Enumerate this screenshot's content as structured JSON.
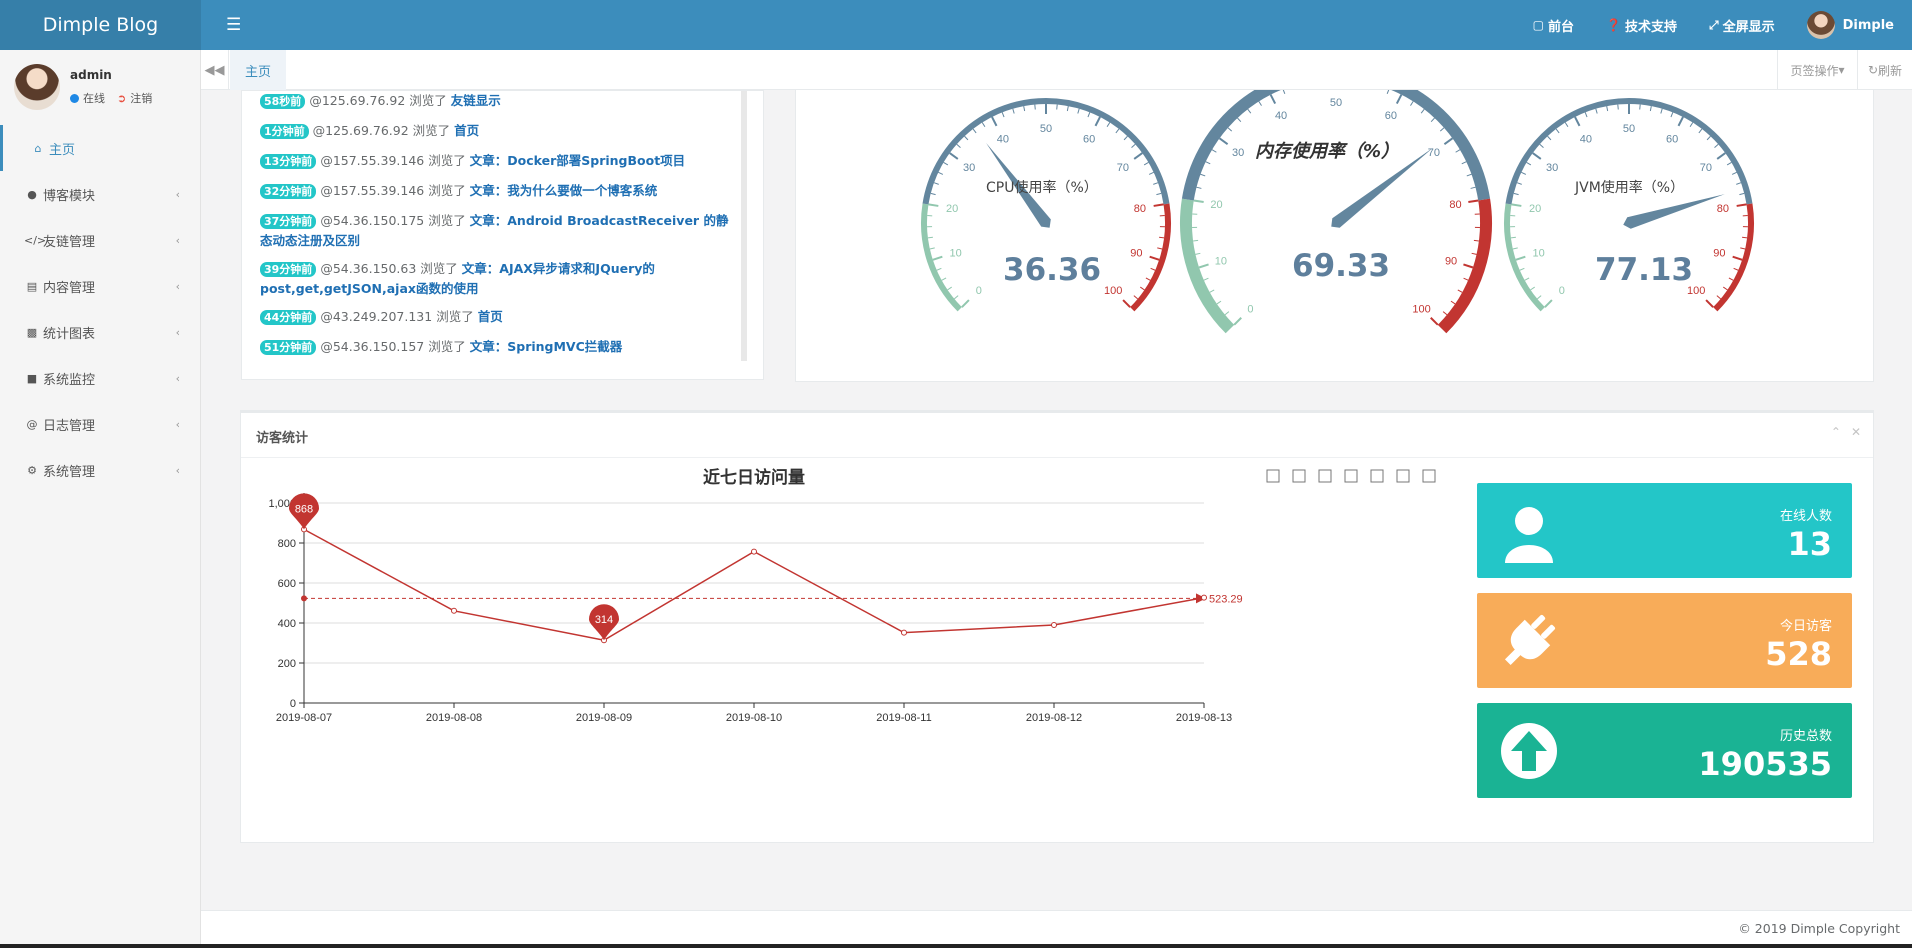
{
  "header": {
    "brand": "Dimple Blog",
    "nav": [
      {
        "icon": "monitor-icon",
        "label": "前台"
      },
      {
        "icon": "question-icon",
        "label": "技术支持"
      },
      {
        "icon": "fullscreen-icon",
        "label": "全屏显示"
      }
    ],
    "username": "Dimple"
  },
  "sidebar": {
    "user": {
      "name": "admin",
      "status": "在线",
      "logout": "注销"
    },
    "items": [
      {
        "icon": "home-icon",
        "label": "主页"
      },
      {
        "icon": "paw-icon",
        "label": "博客模块"
      },
      {
        "icon": "code-icon",
        "label": "友链管理"
      },
      {
        "icon": "archive-icon",
        "label": "内容管理"
      },
      {
        "icon": "bar-chart-icon",
        "label": "统计图表"
      },
      {
        "icon": "video-icon",
        "label": "系统监控"
      },
      {
        "icon": "at-icon",
        "label": "日志管理"
      },
      {
        "icon": "gear-icon",
        "label": "系统管理"
      }
    ]
  },
  "tabs": {
    "active": "主页",
    "ops": "页签操作",
    "refresh": "刷新"
  },
  "log": {
    "entries": [
      {
        "time": "58秒前",
        "ip": "@125.69.76.92",
        "action": "浏览了",
        "target": "友链显示"
      },
      {
        "time": "1分钟前",
        "ip": "@125.69.76.92",
        "action": "浏览了",
        "target": "首页"
      },
      {
        "time": "13分钟前",
        "ip": "@157.55.39.146",
        "action": "浏览了",
        "target": "文章：Docker部署SpringBoot项目"
      },
      {
        "time": "32分钟前",
        "ip": "@157.55.39.146",
        "action": "浏览了",
        "target": "文章：我为什么要做一个博客系统"
      },
      {
        "time": "37分钟前",
        "ip": "@54.36.150.175",
        "action": "浏览了",
        "target": "文章：Android BroadcastReceiver 的静态动态注册及区别"
      },
      {
        "time": "39分钟前",
        "ip": "@54.36.150.63",
        "action": "浏览了",
        "target": "文章：AJAX异步请求和JQuery的post,get,getJSON,ajax函数的使用"
      },
      {
        "time": "44分钟前",
        "ip": "@43.249.207.131",
        "action": "浏览了",
        "target": "首页"
      },
      {
        "time": "51分钟前",
        "ip": "@54.36.150.157",
        "action": "浏览了",
        "target": "文章：SpringMVC拦截器"
      }
    ]
  },
  "gauges": [
    {
      "title": "CPU使用率（%）",
      "value": "36.36",
      "ticks": [
        "0",
        "10",
        "20",
        "30",
        "40",
        "50",
        "60",
        "70",
        "80",
        "90",
        "100"
      ]
    },
    {
      "title": "内存使用率（%）",
      "value": "69.33",
      "ticks": [
        "0",
        "10",
        "20",
        "30",
        "40",
        "50",
        "60",
        "70",
        "80",
        "90",
        "100"
      ]
    },
    {
      "title": "JVM使用率（%）",
      "value": "77.13",
      "ticks": [
        "0",
        "10",
        "20",
        "30",
        "40",
        "50",
        "60",
        "70",
        "80",
        "90",
        "100"
      ]
    }
  ],
  "visitors": {
    "panel_title": "访客统计"
  },
  "chart_data": {
    "type": "line",
    "title": "近七日访问量",
    "x": [
      "2019-08-07",
      "2019-08-08",
      "2019-08-09",
      "2019-08-10",
      "2019-08-11",
      "2019-08-12",
      "2019-08-13"
    ],
    "values": [
      868,
      461,
      314,
      757,
      352,
      390,
      527
    ],
    "ylim": [
      0,
      1000
    ],
    "yticks": [
      "0",
      "200",
      "400",
      "600",
      "800",
      "1,000"
    ],
    "max_marker": "868",
    "min_marker": "314",
    "average": 523.29,
    "average_label": "523.29",
    "color": "#c23531",
    "grid": true
  },
  "stats": [
    {
      "label": "在线人数",
      "value": "13",
      "color": "#23c6c8",
      "icon": "user-icon"
    },
    {
      "label": "今日访客",
      "value": "528",
      "color": "#f8ac59",
      "icon": "plug-icon"
    },
    {
      "label": "历史总数",
      "value": "190535",
      "color": "#1ab394",
      "icon": "arrow-up-circle-icon"
    }
  ],
  "footer": {
    "copyright": "© 2019 Dimple Copyright"
  }
}
